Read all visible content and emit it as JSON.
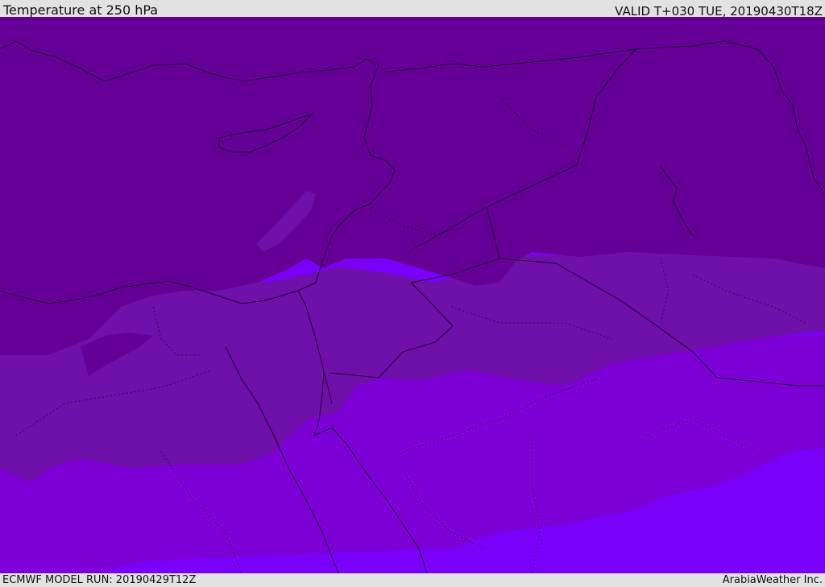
{
  "header": {
    "title": "Temperature at 250 hPa",
    "valid_time": "VALID T+030 TUE, 20190430T18Z"
  },
  "footer": {
    "model_run": "ECMWF MODEL RUN: 20190429T12Z",
    "credit": "ArabiaWeather Inc."
  },
  "colors": {
    "band_coldest": "#640096",
    "band_2": "#7010aa",
    "band_3": "#7d00d6",
    "band_warmest": "#7b00fa",
    "coastline": "#1a0030",
    "background": "#e2e2e2"
  }
}
